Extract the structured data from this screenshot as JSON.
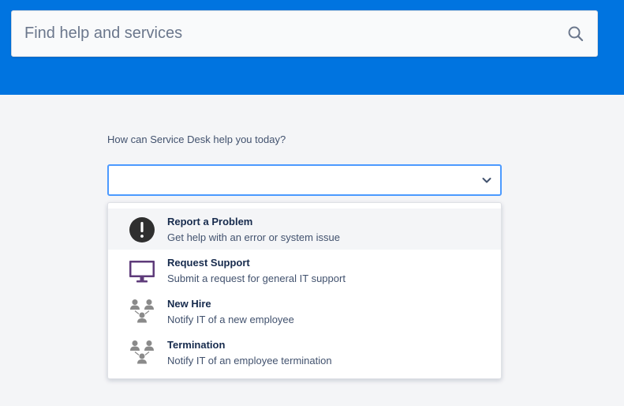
{
  "header": {
    "background_color": "#0074e0",
    "search": {
      "placeholder": "Find help and services",
      "value": "",
      "icon": "search-icon"
    }
  },
  "form": {
    "question": "How can Service Desk help you today?",
    "select": {
      "value": "",
      "icon": "chevron-down-icon",
      "accent_color": "#4c9aff"
    },
    "options": [
      {
        "title": "Report a Problem",
        "description": "Get help with an error or system issue",
        "icon": "exclamation-circle-icon",
        "highlighted": true
      },
      {
        "title": "Request Support",
        "description": "Submit a request for general IT support",
        "icon": "computer-monitor-icon",
        "icon_color": "#5e3b7a"
      },
      {
        "title": "New Hire",
        "description": "Notify IT of a new employee",
        "icon": "people-hierarchy-icon"
      },
      {
        "title": "Termination",
        "description": "Notify IT of an employee termination",
        "icon": "people-hierarchy-icon"
      }
    ]
  }
}
